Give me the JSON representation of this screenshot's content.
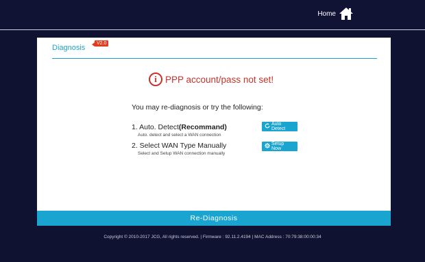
{
  "header": {
    "home_label": "Home",
    "home_icon": "home-icon"
  },
  "panel": {
    "title": "Diagnosis",
    "version": "V2.0",
    "alert_text": "PPP account/pass not set!",
    "alert_icon": "info-icon",
    "subtitle": "You may re-diagnosis or try the following:",
    "options": [
      {
        "prefix": "1. Auto. Detect",
        "bold": "(Recommand)",
        "desc": "Auto. detect and select a WAN connection",
        "button_label": "Auto Detect",
        "button_icon": "refresh-icon"
      },
      {
        "prefix": "2. Select WAN Type Manually",
        "bold": "",
        "desc": "Select and Setup WAN connection manually",
        "button_label": "Setup Now",
        "button_icon": "gear-icon"
      }
    ],
    "rediagnosis_label": "Re-Diagnosis"
  },
  "footer": {
    "text": "Copyright © 2010-2017 JCG, All rights reserved.  |  Firmware : 92.11.2.4194  |  MAC Address : 70:79:38:00:00:34"
  },
  "colors": {
    "accent": "#1aa5d0",
    "alert": "#c7332a",
    "background": "#0f1230",
    "badge": "#e23b1e"
  }
}
